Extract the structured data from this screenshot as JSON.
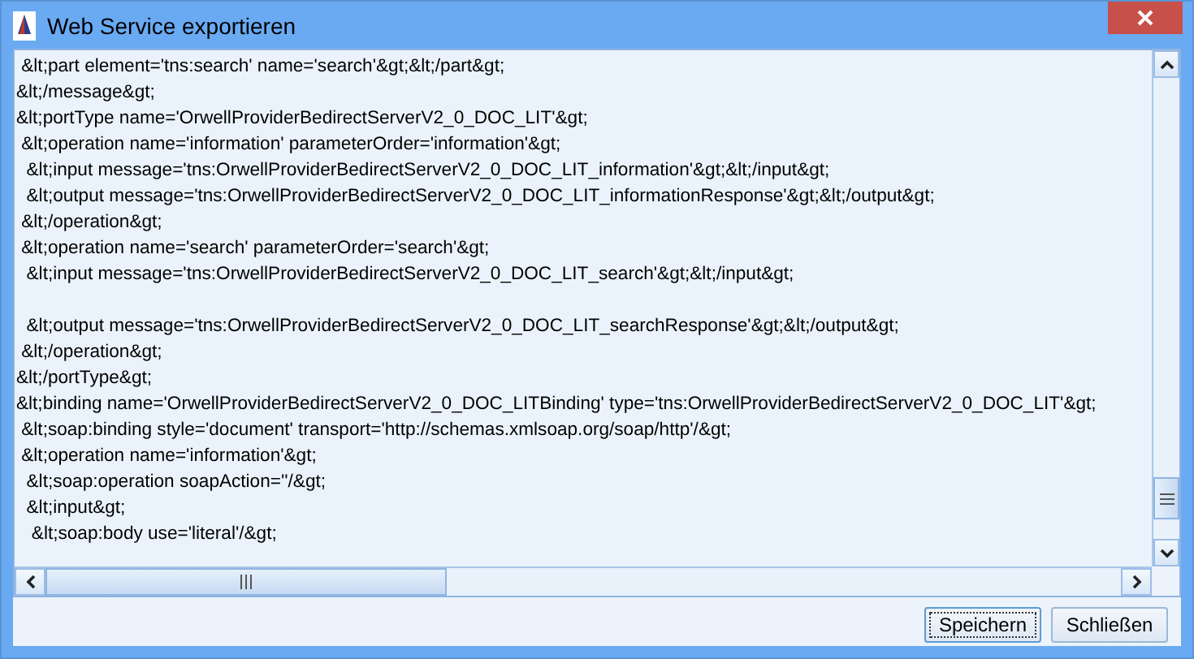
{
  "window": {
    "title": "Web Service exportieren"
  },
  "editor": {
    "lines": [
      {
        "kind": "code",
        "text": " &lt;part element='tns:search' name='search'&gt;&lt;/part&gt;"
      },
      {
        "kind": "code",
        "text": "&lt;/message&gt;"
      },
      {
        "kind": "code",
        "text": "&lt;portType name='OrwellProviderBedirectServerV2_0_DOC_LIT'&gt;"
      },
      {
        "kind": "code",
        "text": " &lt;operation name='information' parameterOrder='information'&gt;"
      },
      {
        "kind": "code",
        "text": "  &lt;input message='tns:OrwellProviderBedirectServerV2_0_DOC_LIT_information'&gt;&lt;/input&gt;"
      },
      {
        "kind": "code",
        "text": "  &lt;output message='tns:OrwellProviderBedirectServerV2_0_DOC_LIT_informationResponse'&gt;&lt;/output&gt;"
      },
      {
        "kind": "code",
        "text": " &lt;/operation&gt;"
      },
      {
        "kind": "code",
        "text": " &lt;operation name='search' parameterOrder='search'&gt;"
      },
      {
        "kind": "code",
        "text": "  &lt;input message='tns:OrwellProviderBedirectServerV2_0_DOC_LIT_search'&gt;&lt;/input&gt;"
      },
      {
        "kind": "blank"
      },
      {
        "kind": "code",
        "text": "  &lt;output message='tns:OrwellProviderBedirectServerV2_0_DOC_LIT_searchResponse'&gt;&lt;/output&gt;"
      },
      {
        "kind": "code",
        "text": " &lt;/operation&gt;"
      },
      {
        "kind": "code",
        "text": "&lt;/portType&gt;"
      },
      {
        "kind": "code",
        "text": "&lt;binding name='OrwellProviderBedirectServerV2_0_DOC_LITBinding' type='tns:OrwellProviderBedirectServerV2_0_DOC_LIT'&gt;"
      },
      {
        "kind": "code",
        "text": " &lt;soap:binding style='document' transport='http://schemas.xmlsoap.org/soap/http'/&gt;"
      },
      {
        "kind": "code",
        "text": " &lt;operation name='information'&gt;"
      },
      {
        "kind": "code",
        "text": "  &lt;soap:operation soapAction=''/&gt;"
      },
      {
        "kind": "code",
        "text": "  &lt;input&gt;"
      },
      {
        "kind": "code",
        "text": "   &lt;soap:body use='literal'/&gt;"
      }
    ]
  },
  "buttons": [
    {
      "label": "Speichern",
      "selected": true
    },
    {
      "label": "Schließen",
      "selected": false
    }
  ]
}
